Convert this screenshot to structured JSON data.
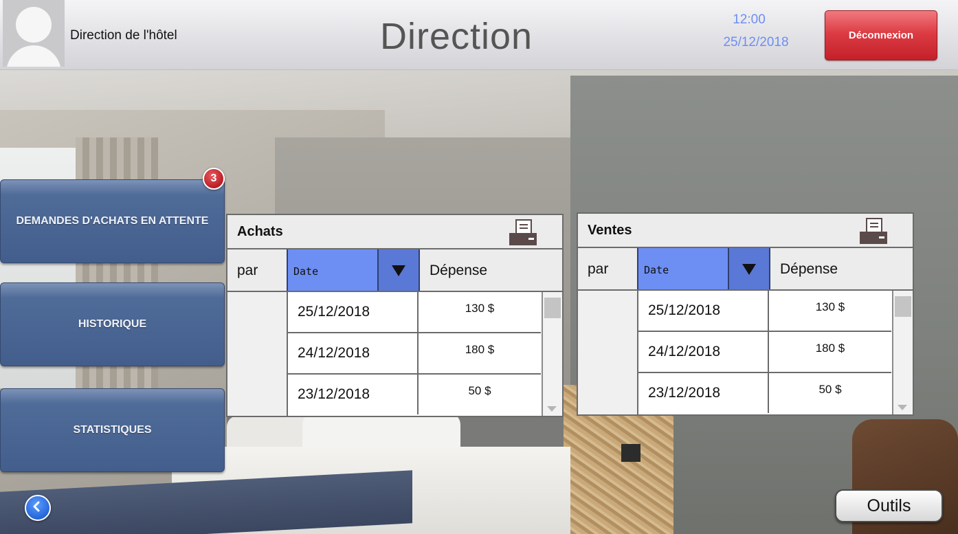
{
  "header": {
    "user_name": "Direction de l'hôtel",
    "page_title": "Direction",
    "time": "12:00",
    "date": "25/12/2018",
    "logout_label": "Déconnexion"
  },
  "menu": {
    "pending_label": "DEMANDES D'ACHATS EN ATTENTE",
    "pending_count": "3",
    "history_label": "HISTORIQUE",
    "stats_label": "STATISTIQUES"
  },
  "tools_label": "Outils",
  "achats": {
    "title": "Achats",
    "par_label": "par",
    "sort_value": "Date",
    "expense_header": "Dépense",
    "rows": [
      {
        "date": "25/12/2018",
        "amount": "130 $"
      },
      {
        "date": "24/12/2018",
        "amount": "180 $"
      },
      {
        "date": "23/12/2018",
        "amount": "50 $"
      }
    ]
  },
  "ventes": {
    "title": "Ventes",
    "par_label": "par",
    "sort_value": "Date",
    "expense_header": "Dépense",
    "rows": [
      {
        "date": "25/12/2018",
        "amount": "130 $"
      },
      {
        "date": "24/12/2018",
        "amount": "180 $"
      },
      {
        "date": "23/12/2018",
        "amount": "50 $"
      }
    ]
  },
  "colors": {
    "accent_blue": "#6d8ef3",
    "logout_red": "#dd3c44",
    "menu_blue": "#4f6b98"
  },
  "icons": [
    "user-avatar-icon",
    "printer-icon",
    "chevron-down-icon",
    "back-arrow-icon",
    "notification-badge"
  ]
}
